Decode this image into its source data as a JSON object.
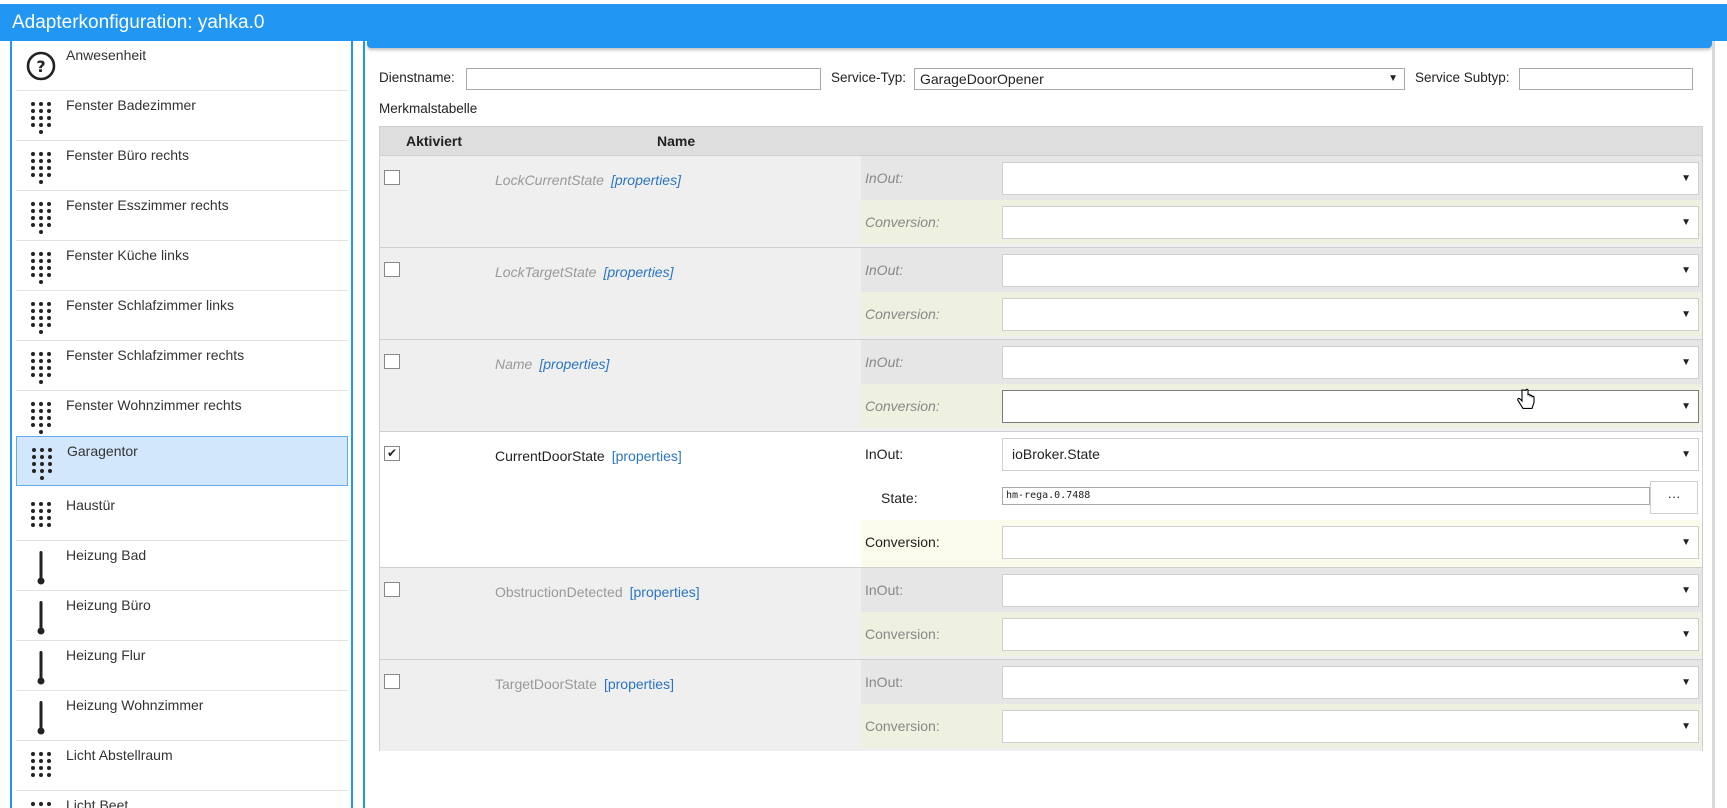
{
  "window": {
    "title": "Adapterkonfiguration: yahka.0"
  },
  "sidebar": {
    "items": [
      {
        "label": "Anwesenheit",
        "icon": "question-circle-icon"
      },
      {
        "label": "Fenster Badezimmer",
        "icon": "keypad-dots-icon"
      },
      {
        "label": "Fenster Büro rechts",
        "icon": "keypad-dots-icon"
      },
      {
        "label": "Fenster Esszimmer rechts",
        "icon": "keypad-dots-icon"
      },
      {
        "label": "Fenster Küche links",
        "icon": "keypad-dots-icon"
      },
      {
        "label": "Fenster Schlafzimmer links",
        "icon": "keypad-dots-icon"
      },
      {
        "label": "Fenster Schlafzimmer rechts",
        "icon": "keypad-dots-icon"
      },
      {
        "label": "Fenster Wohnzimmer rechts",
        "icon": "keypad-dots-icon"
      },
      {
        "label": "Garagentor",
        "icon": "keypad-dots-icon",
        "selected": true
      },
      {
        "label": "Haustür",
        "icon": "keypad-dots-icon"
      },
      {
        "label": "Heizung Bad",
        "icon": "thermometer-icon"
      },
      {
        "label": "Heizung Büro",
        "icon": "thermometer-icon"
      },
      {
        "label": "Heizung Flur",
        "icon": "thermometer-icon"
      },
      {
        "label": "Heizung Wohnzimmer",
        "icon": "thermometer-icon"
      },
      {
        "label": "Licht Abstellraum",
        "icon": "keypad-dots-icon"
      },
      {
        "label": "Licht Beet",
        "icon": "keypad-dots-icon"
      }
    ]
  },
  "service": {
    "name_label": "Dienstname:",
    "name_value": "",
    "type_label": "Service-Typ:",
    "type_value": "GarageDoorOpener",
    "subtype_label": "Service Subtyp:",
    "subtype_value": ""
  },
  "table": {
    "title": "Merkmalstabelle",
    "headers": {
      "activated": "Aktiviert",
      "name": "Name"
    },
    "properties_link": "[properties]",
    "inout_label": "InOut:",
    "conversion_label": "Conversion:",
    "state_label": "State:",
    "more_button": "···",
    "rows": [
      {
        "name": "LockCurrentState",
        "checked": false,
        "inout": "",
        "conversion": ""
      },
      {
        "name": "LockTargetState",
        "checked": false,
        "inout": "",
        "conversion": ""
      },
      {
        "name": "Name",
        "checked": false,
        "inout": "",
        "conversion": ""
      },
      {
        "name": "CurrentDoorState",
        "checked": true,
        "inout": "ioBroker.State",
        "state": "hm-rega.0.7488",
        "conversion": ""
      },
      {
        "name": "ObstructionDetected",
        "checked": false,
        "inout": "",
        "conversion": ""
      },
      {
        "name": "TargetDoorState",
        "checked": false,
        "inout": "",
        "conversion": ""
      }
    ]
  },
  "colors": {
    "accent": "#2196f3",
    "selected_bg": "#d2e7fc",
    "link": "#2a75c4"
  }
}
